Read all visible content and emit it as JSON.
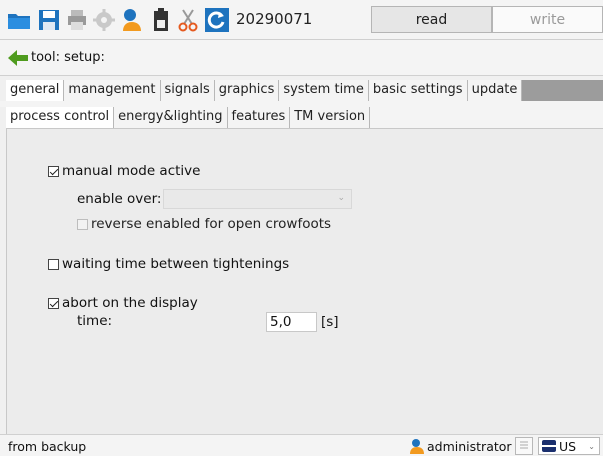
{
  "toolbar": {
    "icons": [
      "folder-icon",
      "save-icon",
      "print-icon",
      "gear-icon",
      "user-icon",
      "battery-icon",
      "scissors-icon",
      "refresh-icon"
    ],
    "record_id": "20290071",
    "read_label": "read",
    "write_label": "write"
  },
  "breadcrumb": {
    "text": "tool: setup:"
  },
  "tabs_primary": [
    "general",
    "management",
    "signals",
    "graphics",
    "system time",
    "basic settings",
    "update"
  ],
  "tabs_secondary": [
    "process control",
    "energy&lighting",
    "features",
    "TM version"
  ],
  "form": {
    "manual_mode": {
      "label": "manual mode active",
      "checked": true
    },
    "enable_over": {
      "label": "enable over:",
      "value": ""
    },
    "reverse": {
      "label": "reverse enabled for open crowfoots",
      "checked": false,
      "disabled": true
    },
    "waiting": {
      "label": "waiting time between tightenings",
      "checked": false
    },
    "abort": {
      "label": "abort on the display",
      "checked": true
    },
    "time": {
      "label": "time:",
      "value": "5,0",
      "unit": "[s]"
    }
  },
  "status": {
    "left_text": "from backup",
    "user": "administrator",
    "language": "US"
  },
  "colors": {
    "accent_blue": "#1e73be",
    "toolbar_bg": "#f4f4f4",
    "tab_bar_bg": "#9c9c9c"
  }
}
